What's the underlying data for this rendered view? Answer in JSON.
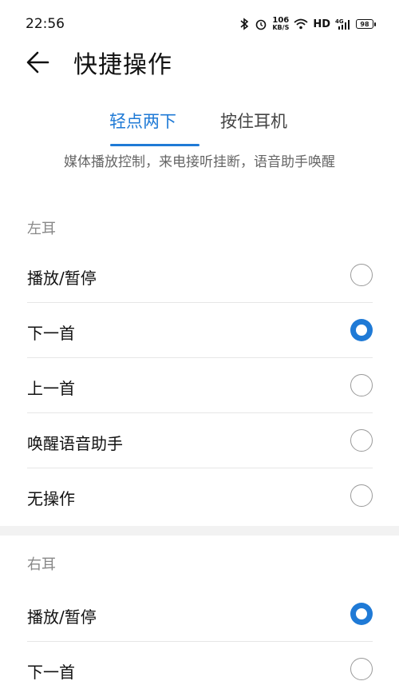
{
  "status_bar": {
    "time": "22:56",
    "net_speed_value": "106",
    "net_speed_unit": "KB/S",
    "hd_label": "HD",
    "signal_label": "4G",
    "battery": "98"
  },
  "header": {
    "title": "快捷操作"
  },
  "tabs": [
    {
      "label": "轻点两下",
      "active": true
    },
    {
      "label": "按住耳机",
      "active": false
    }
  ],
  "subtitle": "媒体播放控制，来电接听挂断，语音助手唤醒",
  "left_ear": {
    "label": "左耳",
    "options": [
      {
        "label": "播放/暂停",
        "selected": false
      },
      {
        "label": "下一首",
        "selected": true
      },
      {
        "label": "上一首",
        "selected": false
      },
      {
        "label": "唤醒语音助手",
        "selected": false
      },
      {
        "label": "无操作",
        "selected": false
      }
    ]
  },
  "right_ear": {
    "label": "右耳",
    "options": [
      {
        "label": "播放/暂停",
        "selected": true
      },
      {
        "label": "下一首",
        "selected": false
      }
    ]
  },
  "colors": {
    "accent": "#1f7ad6",
    "section_band": "#f2f2f2"
  }
}
